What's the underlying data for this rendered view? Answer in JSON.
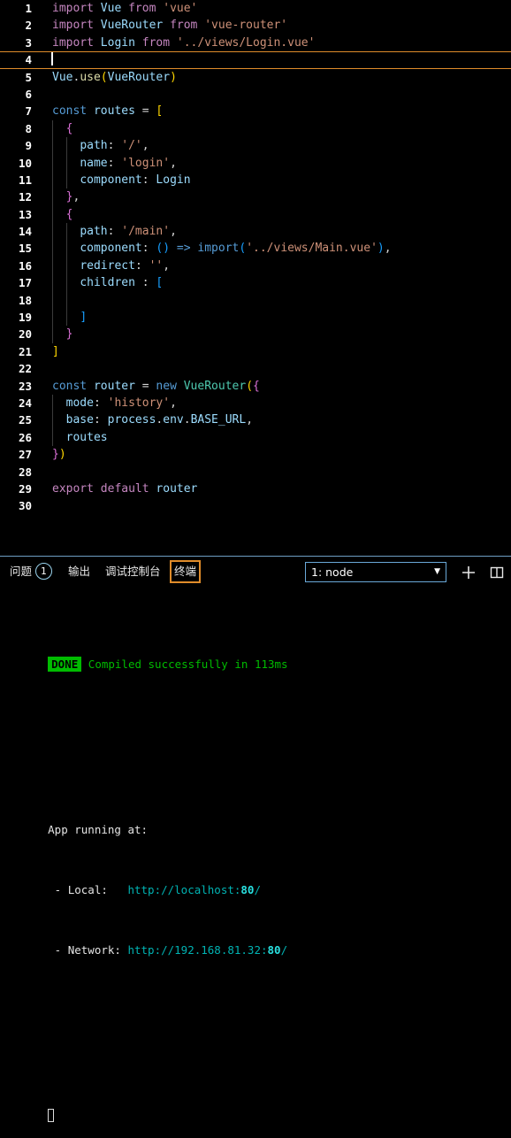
{
  "editor": {
    "active_line": 4,
    "lines": [
      {
        "n": 1,
        "tokens": [
          {
            "t": "import",
            "c": "t-kw"
          },
          {
            "t": " ",
            "c": "t-plain"
          },
          {
            "t": "Vue",
            "c": "t-var"
          },
          {
            "t": " ",
            "c": "t-plain"
          },
          {
            "t": "from",
            "c": "t-kw"
          },
          {
            "t": " ",
            "c": "t-plain"
          },
          {
            "t": "'vue'",
            "c": "t-str"
          }
        ]
      },
      {
        "n": 2,
        "tokens": [
          {
            "t": "import",
            "c": "t-kw"
          },
          {
            "t": " ",
            "c": "t-plain"
          },
          {
            "t": "VueRouter",
            "c": "t-var"
          },
          {
            "t": " ",
            "c": "t-plain"
          },
          {
            "t": "from",
            "c": "t-kw"
          },
          {
            "t": " ",
            "c": "t-plain"
          },
          {
            "t": "'vue-router'",
            "c": "t-str"
          }
        ]
      },
      {
        "n": 3,
        "tokens": [
          {
            "t": "import",
            "c": "t-kw"
          },
          {
            "t": " ",
            "c": "t-plain"
          },
          {
            "t": "Login",
            "c": "t-var"
          },
          {
            "t": " ",
            "c": "t-plain"
          },
          {
            "t": "from",
            "c": "t-kw"
          },
          {
            "t": " ",
            "c": "t-plain"
          },
          {
            "t": "'../views/Login.vue'",
            "c": "t-str"
          }
        ]
      },
      {
        "n": 4,
        "tokens": []
      },
      {
        "n": 5,
        "tokens": [
          {
            "t": "Vue",
            "c": "t-var"
          },
          {
            "t": ".",
            "c": "t-plain"
          },
          {
            "t": "use",
            "c": "t-fn"
          },
          {
            "t": "(",
            "c": "t-brkt1"
          },
          {
            "t": "VueRouter",
            "c": "t-var"
          },
          {
            "t": ")",
            "c": "t-brkt1"
          }
        ]
      },
      {
        "n": 6,
        "tokens": []
      },
      {
        "n": 7,
        "tokens": [
          {
            "t": "const",
            "c": "t-ctrl"
          },
          {
            "t": " ",
            "c": "t-plain"
          },
          {
            "t": "routes",
            "c": "t-var"
          },
          {
            "t": " ",
            "c": "t-plain"
          },
          {
            "t": "=",
            "c": "t-op"
          },
          {
            "t": " ",
            "c": "t-plain"
          },
          {
            "t": "[",
            "c": "t-brkt1"
          }
        ]
      },
      {
        "n": 8,
        "tokens": [
          {
            "t": "  ",
            "c": "t-plain"
          },
          {
            "t": "{",
            "c": "t-brkt2"
          }
        ]
      },
      {
        "n": 9,
        "tokens": [
          {
            "t": "    ",
            "c": "t-plain"
          },
          {
            "t": "path",
            "c": "t-var"
          },
          {
            "t": ": ",
            "c": "t-plain"
          },
          {
            "t": "'/'",
            "c": "t-str"
          },
          {
            "t": ",",
            "c": "t-plain"
          }
        ]
      },
      {
        "n": 10,
        "tokens": [
          {
            "t": "    ",
            "c": "t-plain"
          },
          {
            "t": "name",
            "c": "t-var"
          },
          {
            "t": ": ",
            "c": "t-plain"
          },
          {
            "t": "'login'",
            "c": "t-str"
          },
          {
            "t": ",",
            "c": "t-plain"
          }
        ]
      },
      {
        "n": 11,
        "tokens": [
          {
            "t": "    ",
            "c": "t-plain"
          },
          {
            "t": "component",
            "c": "t-var"
          },
          {
            "t": ": ",
            "c": "t-plain"
          },
          {
            "t": "Login",
            "c": "t-var"
          }
        ]
      },
      {
        "n": 12,
        "tokens": [
          {
            "t": "  ",
            "c": "t-plain"
          },
          {
            "t": "}",
            "c": "t-brkt2"
          },
          {
            "t": ",",
            "c": "t-plain"
          }
        ]
      },
      {
        "n": 13,
        "tokens": [
          {
            "t": "  ",
            "c": "t-plain"
          },
          {
            "t": "{",
            "c": "t-brkt2"
          }
        ]
      },
      {
        "n": 14,
        "tokens": [
          {
            "t": "    ",
            "c": "t-plain"
          },
          {
            "t": "path",
            "c": "t-var"
          },
          {
            "t": ": ",
            "c": "t-plain"
          },
          {
            "t": "'/main'",
            "c": "t-str"
          },
          {
            "t": ",",
            "c": "t-plain"
          }
        ]
      },
      {
        "n": 15,
        "tokens": [
          {
            "t": "    ",
            "c": "t-plain"
          },
          {
            "t": "component",
            "c": "t-var"
          },
          {
            "t": ": ",
            "c": "t-plain"
          },
          {
            "t": "(",
            "c": "t-brkt3"
          },
          {
            "t": ")",
            "c": "t-brkt3"
          },
          {
            "t": " ",
            "c": "t-plain"
          },
          {
            "t": "=>",
            "c": "t-ctrl"
          },
          {
            "t": " ",
            "c": "t-plain"
          },
          {
            "t": "import",
            "c": "t-ctrl"
          },
          {
            "t": "(",
            "c": "t-brkt3"
          },
          {
            "t": "'../views/Main.vue'",
            "c": "t-str"
          },
          {
            "t": ")",
            "c": "t-brkt3"
          },
          {
            "t": ",",
            "c": "t-plain"
          }
        ]
      },
      {
        "n": 16,
        "tokens": [
          {
            "t": "    ",
            "c": "t-plain"
          },
          {
            "t": "redirect",
            "c": "t-var"
          },
          {
            "t": ": ",
            "c": "t-plain"
          },
          {
            "t": "''",
            "c": "t-str"
          },
          {
            "t": ",",
            "c": "t-plain"
          }
        ]
      },
      {
        "n": 17,
        "tokens": [
          {
            "t": "    ",
            "c": "t-plain"
          },
          {
            "t": "children",
            "c": "t-var"
          },
          {
            "t": " : ",
            "c": "t-plain"
          },
          {
            "t": "[",
            "c": "t-brkt3"
          }
        ]
      },
      {
        "n": 18,
        "tokens": []
      },
      {
        "n": 19,
        "tokens": [
          {
            "t": "    ",
            "c": "t-plain"
          },
          {
            "t": "]",
            "c": "t-brkt3"
          }
        ]
      },
      {
        "n": 20,
        "tokens": [
          {
            "t": "  ",
            "c": "t-plain"
          },
          {
            "t": "}",
            "c": "t-brkt2"
          }
        ]
      },
      {
        "n": 21,
        "tokens": [
          {
            "t": "]",
            "c": "t-brkt1"
          }
        ]
      },
      {
        "n": 22,
        "tokens": []
      },
      {
        "n": 23,
        "tokens": [
          {
            "t": "const",
            "c": "t-ctrl"
          },
          {
            "t": " ",
            "c": "t-plain"
          },
          {
            "t": "router",
            "c": "t-var"
          },
          {
            "t": " ",
            "c": "t-plain"
          },
          {
            "t": "=",
            "c": "t-op"
          },
          {
            "t": " ",
            "c": "t-plain"
          },
          {
            "t": "new",
            "c": "t-ctrl"
          },
          {
            "t": " ",
            "c": "t-plain"
          },
          {
            "t": "VueRouter",
            "c": "t-type"
          },
          {
            "t": "(",
            "c": "t-brkt1"
          },
          {
            "t": "{",
            "c": "t-brkt2"
          }
        ]
      },
      {
        "n": 24,
        "tokens": [
          {
            "t": "  ",
            "c": "t-plain"
          },
          {
            "t": "mode",
            "c": "t-var"
          },
          {
            "t": ": ",
            "c": "t-plain"
          },
          {
            "t": "'history'",
            "c": "t-str"
          },
          {
            "t": ",",
            "c": "t-plain"
          }
        ]
      },
      {
        "n": 25,
        "tokens": [
          {
            "t": "  ",
            "c": "t-plain"
          },
          {
            "t": "base",
            "c": "t-var"
          },
          {
            "t": ": ",
            "c": "t-plain"
          },
          {
            "t": "process",
            "c": "t-var"
          },
          {
            "t": ".",
            "c": "t-plain"
          },
          {
            "t": "env",
            "c": "t-var"
          },
          {
            "t": ".",
            "c": "t-plain"
          },
          {
            "t": "BASE_URL",
            "c": "t-var"
          },
          {
            "t": ",",
            "c": "t-plain"
          }
        ]
      },
      {
        "n": 26,
        "tokens": [
          {
            "t": "  ",
            "c": "t-plain"
          },
          {
            "t": "routes",
            "c": "t-var"
          }
        ]
      },
      {
        "n": 27,
        "tokens": [
          {
            "t": "}",
            "c": "t-brkt2"
          },
          {
            "t": ")",
            "c": "t-brkt1"
          }
        ]
      },
      {
        "n": 28,
        "tokens": []
      },
      {
        "n": 29,
        "tokens": [
          {
            "t": "export",
            "c": "t-kw"
          },
          {
            "t": " ",
            "c": "t-plain"
          },
          {
            "t": "default",
            "c": "t-kw"
          },
          {
            "t": " ",
            "c": "t-plain"
          },
          {
            "t": "router",
            "c": "t-var"
          }
        ]
      },
      {
        "n": 30,
        "tokens": []
      }
    ]
  },
  "panel": {
    "tabs": [
      {
        "label": "问题",
        "badge": "1",
        "focused": false
      },
      {
        "label": "输出",
        "badge": null,
        "focused": false
      },
      {
        "label": "调试控制台",
        "badge": null,
        "focused": false
      },
      {
        "label": "终端",
        "badge": null,
        "focused": true
      }
    ],
    "terminal_select": {
      "value": "1: node",
      "caret": "▼"
    },
    "new_terminal_label": "+",
    "split_terminal_label": "split-terminal"
  },
  "terminal": {
    "status_badge": "DONE",
    "status_message": "Compiled successfully in 113ms",
    "blank_1": "",
    "running_header": "App running at:",
    "local_label": " - Local:   ",
    "local_url_base": "http://localhost:",
    "local_url_port": "80",
    "local_url_tail": "/",
    "network_label": " - Network: ",
    "network_url_base": "http://192.168.81.32:",
    "network_url_port": "80",
    "network_url_tail": "/"
  },
  "colors": {
    "background": "#000000",
    "active_line_border": "#e08c2a",
    "panel_divider": "#6f9fc4",
    "focus_border": "#e08c2a",
    "select_border": "#6aa9d8",
    "badge_border": "#9ad4ee",
    "terminal_green": "#00bb00",
    "terminal_cyan": "#00b3b3"
  }
}
